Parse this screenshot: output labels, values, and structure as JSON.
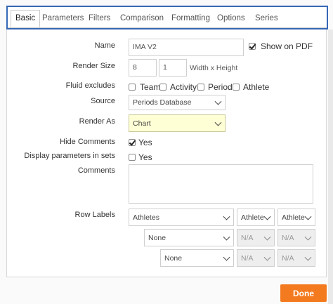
{
  "tabs": [
    "Basic",
    "Parameters",
    "Filters",
    "Comparison",
    "Formatting",
    "Options",
    "Series"
  ],
  "active_tab": "Basic",
  "form": {
    "name_label": "Name",
    "name_value": "IMA V2",
    "show_on_pdf_label": "Show on PDF",
    "show_on_pdf_checked": true,
    "render_size_label": "Render Size",
    "render_width": "8",
    "render_height": "1",
    "render_size_hint": "Width x Height",
    "fluid_excludes_label": "Fluid excludes",
    "fluid_options": [
      {
        "label": "Team",
        "checked": false
      },
      {
        "label": "Activity",
        "checked": false
      },
      {
        "label": "Period",
        "checked": false
      },
      {
        "label": "Athlete",
        "checked": false
      }
    ],
    "source_label": "Source",
    "source_value": "Periods Database",
    "render_as_label": "Render As",
    "render_as_value": "Chart",
    "hide_comments_label": "Hide Comments",
    "hide_comments_option": "Yes",
    "hide_comments_checked": true,
    "display_params_label": "Display parameters in sets",
    "display_params_option": "Yes",
    "display_params_checked": false,
    "comments_label": "Comments",
    "comments_value": "",
    "row_labels_label": "Row Labels",
    "row_labels": [
      {
        "select": "Athletes",
        "col2": "Athlete Pr",
        "col3": "Athlete Pr"
      },
      {
        "select": "None",
        "col2": "N/A",
        "col3": "N/A"
      },
      {
        "select": "None",
        "col2": "N/A",
        "col3": "N/A"
      }
    ]
  },
  "done_label": "Done",
  "colors": {
    "accent": "#3567b6",
    "done": "#f47a20",
    "highlight": "#ffffd6"
  }
}
